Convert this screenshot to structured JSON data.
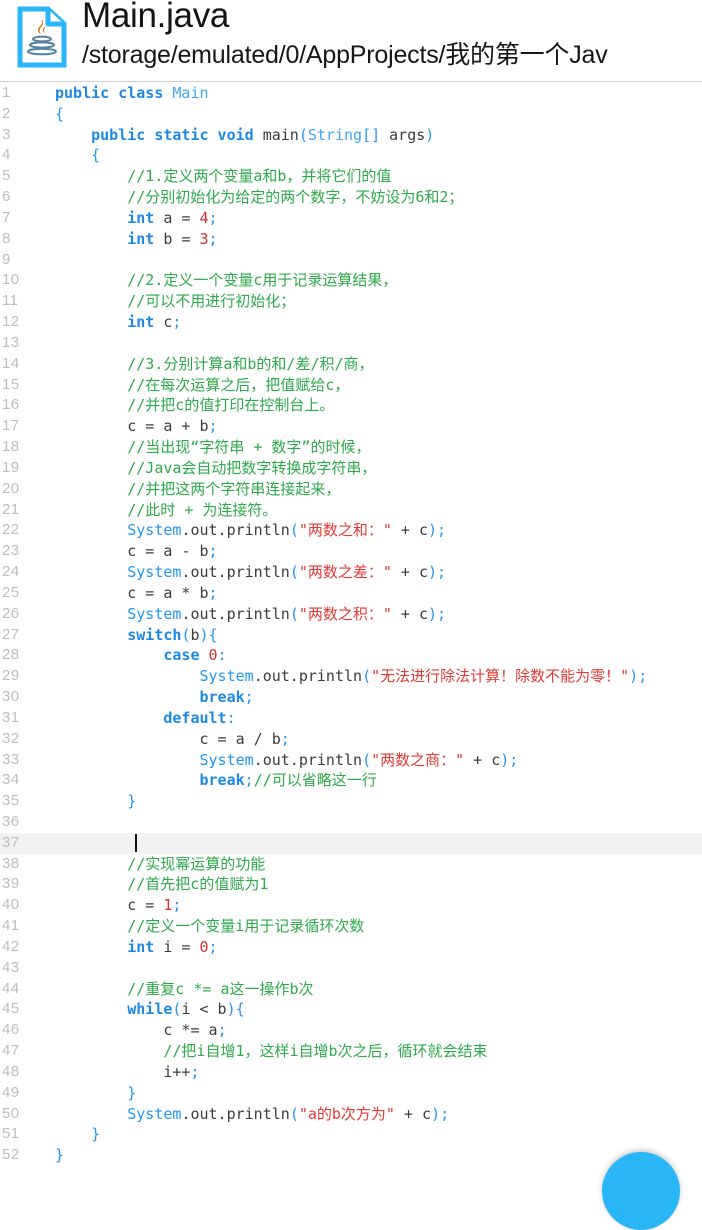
{
  "header": {
    "icon_name": "java-file-icon",
    "title": "Main.java",
    "path": "/storage/emulated/0/AppProjects/我的第一个Jav"
  },
  "colors": {
    "accent": "#29b6f6",
    "icon_blue": "#29b6f6",
    "java_logo_orange": "#e76f00",
    "keyword": "#1e88e5",
    "type": "#42a5f5",
    "string": "#e53935",
    "number": "#d32f2f",
    "comment": "#2eaa4a",
    "plain": "#3b3b3b",
    "gutter": "#bdbdbd",
    "active_line_bg": "#f2f2f2",
    "cursor": "#101010"
  },
  "editor": {
    "language": "java",
    "active_line": 37,
    "cursor_line": 37,
    "first_visible_line": 1,
    "last_visible_line": 52,
    "lines": [
      {
        "n": 1,
        "tokens": [
          [
            "kw",
            "public class "
          ],
          [
            "typ",
            "Main"
          ]
        ]
      },
      {
        "n": 2,
        "tokens": [
          [
            "pun",
            "{"
          ]
        ]
      },
      {
        "n": 3,
        "tokens": [
          [
            "pln",
            "    "
          ],
          [
            "kw",
            "public static void "
          ],
          [
            "pln",
            "main"
          ],
          [
            "pun",
            "("
          ],
          [
            "typ",
            "String"
          ],
          [
            "pun",
            "[]"
          ],
          [
            "pln",
            " args"
          ],
          [
            "pun",
            ")"
          ]
        ]
      },
      {
        "n": 4,
        "tokens": [
          [
            "pln",
            "    "
          ],
          [
            "pun",
            "{"
          ]
        ]
      },
      {
        "n": 5,
        "tokens": [
          [
            "pln",
            "        "
          ],
          [
            "cmt",
            "//1.定义两个变量a和b，并将它们的值"
          ]
        ]
      },
      {
        "n": 6,
        "tokens": [
          [
            "pln",
            "        "
          ],
          [
            "cmt",
            "//分别初始化为给定的两个数字，不妨设为6和2；"
          ]
        ]
      },
      {
        "n": 7,
        "tokens": [
          [
            "pln",
            "        "
          ],
          [
            "kw",
            "int "
          ],
          [
            "pln",
            "a "
          ],
          [
            "pln",
            "= "
          ],
          [
            "num",
            "4"
          ],
          [
            "pun",
            ";"
          ]
        ]
      },
      {
        "n": 8,
        "tokens": [
          [
            "pln",
            "        "
          ],
          [
            "kw",
            "int "
          ],
          [
            "pln",
            "b "
          ],
          [
            "pln",
            "= "
          ],
          [
            "num",
            "3"
          ],
          [
            "pun",
            ";"
          ]
        ]
      },
      {
        "n": 9,
        "tokens": []
      },
      {
        "n": 10,
        "tokens": [
          [
            "pln",
            "        "
          ],
          [
            "cmt",
            "//2.定义一个变量c用于记录运算结果，"
          ]
        ]
      },
      {
        "n": 11,
        "tokens": [
          [
            "pln",
            "        "
          ],
          [
            "cmt",
            "//可以不用进行初始化；"
          ]
        ]
      },
      {
        "n": 12,
        "tokens": [
          [
            "pln",
            "        "
          ],
          [
            "kw",
            "int "
          ],
          [
            "pln",
            "c"
          ],
          [
            "pun",
            ";"
          ]
        ]
      },
      {
        "n": 13,
        "tokens": []
      },
      {
        "n": 14,
        "tokens": [
          [
            "pln",
            "        "
          ],
          [
            "cmt",
            "//3.分别计算a和b的和/差/积/商，"
          ]
        ]
      },
      {
        "n": 15,
        "tokens": [
          [
            "pln",
            "        "
          ],
          [
            "cmt",
            "//在每次运算之后，把值赋给c，"
          ]
        ]
      },
      {
        "n": 16,
        "tokens": [
          [
            "pln",
            "        "
          ],
          [
            "cmt",
            "//并把c的值打印在控制台上。"
          ]
        ]
      },
      {
        "n": 17,
        "tokens": [
          [
            "pln",
            "        c = a + b"
          ],
          [
            "pun",
            ";"
          ]
        ]
      },
      {
        "n": 18,
        "tokens": [
          [
            "pln",
            "        "
          ],
          [
            "cmt",
            "//当出现“字符串 + 数字”的时候，"
          ]
        ]
      },
      {
        "n": 19,
        "tokens": [
          [
            "pln",
            "        "
          ],
          [
            "cmt",
            "//Java会自动把数字转换成字符串，"
          ]
        ]
      },
      {
        "n": 20,
        "tokens": [
          [
            "pln",
            "        "
          ],
          [
            "cmt",
            "//并把这两个字符串连接起来，"
          ]
        ]
      },
      {
        "n": 21,
        "tokens": [
          [
            "pln",
            "        "
          ],
          [
            "cmt",
            "//此时 + 为连接符。"
          ]
        ]
      },
      {
        "n": 22,
        "tokens": [
          [
            "pln",
            "        "
          ],
          [
            "sys",
            "System"
          ],
          [
            "pln",
            ".out.println"
          ],
          [
            "pun",
            "("
          ],
          [
            "str",
            "\"两数之和：\""
          ],
          [
            "pln",
            " + c"
          ],
          [
            "pun",
            ");"
          ]
        ]
      },
      {
        "n": 23,
        "tokens": [
          [
            "pln",
            "        c = a - b"
          ],
          [
            "pun",
            ";"
          ]
        ]
      },
      {
        "n": 24,
        "tokens": [
          [
            "pln",
            "        "
          ],
          [
            "sys",
            "System"
          ],
          [
            "pln",
            ".out.println"
          ],
          [
            "pun",
            "("
          ],
          [
            "str",
            "\"两数之差：\""
          ],
          [
            "pln",
            " + c"
          ],
          [
            "pun",
            ");"
          ]
        ]
      },
      {
        "n": 25,
        "tokens": [
          [
            "pln",
            "        c = a * b"
          ],
          [
            "pun",
            ";"
          ]
        ]
      },
      {
        "n": 26,
        "tokens": [
          [
            "pln",
            "        "
          ],
          [
            "sys",
            "System"
          ],
          [
            "pln",
            ".out.println"
          ],
          [
            "pun",
            "("
          ],
          [
            "str",
            "\"两数之积：\""
          ],
          [
            "pln",
            " + c"
          ],
          [
            "pun",
            ");"
          ]
        ]
      },
      {
        "n": 27,
        "tokens": [
          [
            "pln",
            "        "
          ],
          [
            "kw",
            "switch"
          ],
          [
            "pun",
            "("
          ],
          [
            "pln",
            "b"
          ],
          [
            "pun",
            "){"
          ]
        ]
      },
      {
        "n": 28,
        "tokens": [
          [
            "pln",
            "            "
          ],
          [
            "kw",
            "case "
          ],
          [
            "num",
            "0"
          ],
          [
            "pun",
            ":"
          ]
        ]
      },
      {
        "n": 29,
        "tokens": [
          [
            "pln",
            "                "
          ],
          [
            "sys",
            "System"
          ],
          [
            "pln",
            ".out.println"
          ],
          [
            "pun",
            "("
          ],
          [
            "str",
            "\"无法进行除法计算！除数不能为零！\""
          ],
          [
            "pun",
            ");"
          ]
        ]
      },
      {
        "n": 30,
        "tokens": [
          [
            "pln",
            "                "
          ],
          [
            "kw",
            "break"
          ],
          [
            "pun",
            ";"
          ]
        ]
      },
      {
        "n": 31,
        "tokens": [
          [
            "pln",
            "            "
          ],
          [
            "kw",
            "default"
          ],
          [
            "pun",
            ":"
          ]
        ]
      },
      {
        "n": 32,
        "tokens": [
          [
            "pln",
            "                c = a / b"
          ],
          [
            "pun",
            ";"
          ]
        ]
      },
      {
        "n": 33,
        "tokens": [
          [
            "pln",
            "                "
          ],
          [
            "sys",
            "System"
          ],
          [
            "pln",
            ".out.println"
          ],
          [
            "pun",
            "("
          ],
          [
            "str",
            "\"两数之商：\""
          ],
          [
            "pln",
            " + c"
          ],
          [
            "pun",
            ");"
          ]
        ]
      },
      {
        "n": 34,
        "tokens": [
          [
            "pln",
            "                "
          ],
          [
            "kw",
            "break"
          ],
          [
            "pun",
            ";"
          ],
          [
            "cmt",
            "//可以省略这一行"
          ]
        ]
      },
      {
        "n": 35,
        "tokens": [
          [
            "pln",
            "        "
          ],
          [
            "pun",
            "}"
          ]
        ]
      },
      {
        "n": 36,
        "tokens": []
      },
      {
        "n": 37,
        "tokens": [
          [
            "pln",
            "        "
          ]
        ]
      },
      {
        "n": 38,
        "tokens": [
          [
            "pln",
            "        "
          ],
          [
            "cmt",
            "//实现幂运算的功能"
          ]
        ]
      },
      {
        "n": 39,
        "tokens": [
          [
            "pln",
            "        "
          ],
          [
            "cmt",
            "//首先把c的值赋为1"
          ]
        ]
      },
      {
        "n": 40,
        "tokens": [
          [
            "pln",
            "        c = "
          ],
          [
            "num",
            "1"
          ],
          [
            "pun",
            ";"
          ]
        ]
      },
      {
        "n": 41,
        "tokens": [
          [
            "pln",
            "        "
          ],
          [
            "cmt",
            "//定义一个变量i用于记录循环次数"
          ]
        ]
      },
      {
        "n": 42,
        "tokens": [
          [
            "pln",
            "        "
          ],
          [
            "kw",
            "int "
          ],
          [
            "pln",
            "i = "
          ],
          [
            "num",
            "0"
          ],
          [
            "pun",
            ";"
          ]
        ]
      },
      {
        "n": 43,
        "tokens": []
      },
      {
        "n": 44,
        "tokens": [
          [
            "pln",
            "        "
          ],
          [
            "cmt",
            "//重复c *= a这一操作b次"
          ]
        ]
      },
      {
        "n": 45,
        "tokens": [
          [
            "pln",
            "        "
          ],
          [
            "kw",
            "while"
          ],
          [
            "pun",
            "("
          ],
          [
            "pln",
            "i < b"
          ],
          [
            "pun",
            "){"
          ]
        ]
      },
      {
        "n": 46,
        "tokens": [
          [
            "pln",
            "            c *= a"
          ],
          [
            "pun",
            ";"
          ]
        ]
      },
      {
        "n": 47,
        "tokens": [
          [
            "pln",
            "            "
          ],
          [
            "cmt",
            "//把i自增1，这样i自增b次之后，循环就会结束"
          ]
        ]
      },
      {
        "n": 48,
        "tokens": [
          [
            "pln",
            "            i++"
          ],
          [
            "pun",
            ";"
          ]
        ]
      },
      {
        "n": 49,
        "tokens": [
          [
            "pln",
            "        "
          ],
          [
            "pun",
            "}"
          ]
        ]
      },
      {
        "n": 50,
        "tokens": [
          [
            "pln",
            "        "
          ],
          [
            "sys",
            "System"
          ],
          [
            "pln",
            ".out.println"
          ],
          [
            "pun",
            "("
          ],
          [
            "str",
            "\"a的b次方为\""
          ],
          [
            "pln",
            " + c"
          ],
          [
            "pun",
            ");"
          ]
        ]
      },
      {
        "n": 51,
        "tokens": [
          [
            "pln",
            "    "
          ],
          [
            "pun",
            "}"
          ]
        ]
      },
      {
        "n": 52,
        "tokens": [
          [
            "pun",
            "}"
          ]
        ]
      }
    ]
  },
  "fab": {
    "name": "run-fab",
    "color": "#29b6f6"
  }
}
